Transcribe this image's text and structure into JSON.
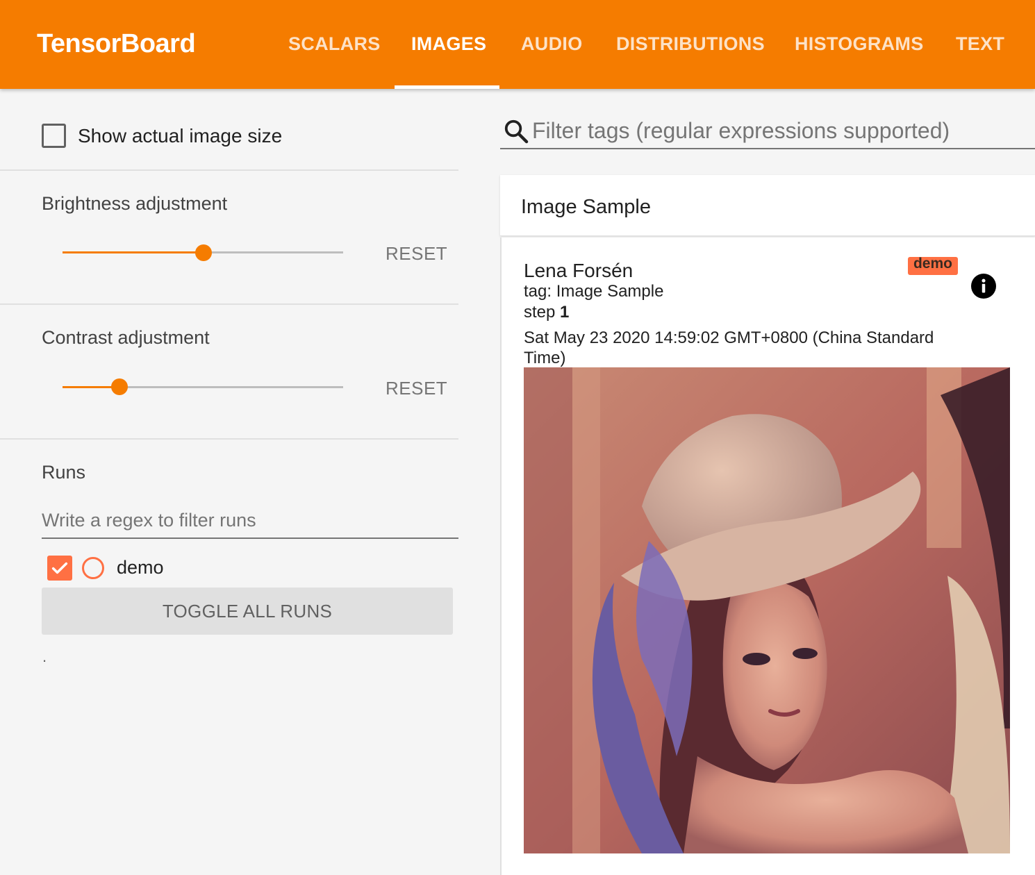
{
  "header": {
    "title": "TensorBoard",
    "tabs": [
      {
        "label": "SCALARS"
      },
      {
        "label": "IMAGES"
      },
      {
        "label": "AUDIO"
      },
      {
        "label": "DISTRIBUTIONS"
      },
      {
        "label": "HISTOGRAMS"
      },
      {
        "label": "TEXT"
      }
    ],
    "active_tab": "IMAGES",
    "bg_color": "#f57c00"
  },
  "sidebar": {
    "show_actual_size_label": "Show actual image size",
    "show_actual_size_checked": false,
    "brightness": {
      "label": "Brightness adjustment",
      "reset_label": "RESET",
      "value_fraction": 0.5
    },
    "contrast": {
      "label": "Contrast adjustment",
      "reset_label": "RESET",
      "value_fraction": 0.2
    },
    "runs": {
      "title": "Runs",
      "filter_placeholder": "Write a regex to filter runs",
      "items": [
        {
          "name": "demo",
          "checked": true,
          "color": "#ff7043"
        }
      ],
      "toggle_label": "TOGGLE ALL RUNS",
      "footer": "."
    }
  },
  "main": {
    "filter_placeholder": "Filter tags (regular expressions supported)",
    "card": {
      "title": "Image Sample",
      "run_name": "Lena Forsén",
      "run_badge": "demo",
      "tag": "tag: Image Sample",
      "step_label": "step",
      "step_value": "1",
      "timestamp": "Sat May 23 2020 14:59:02 GMT+0800 (China Standard Time)"
    }
  },
  "icons": {
    "search": "search-icon",
    "info": "info-icon",
    "check": "check-icon"
  }
}
